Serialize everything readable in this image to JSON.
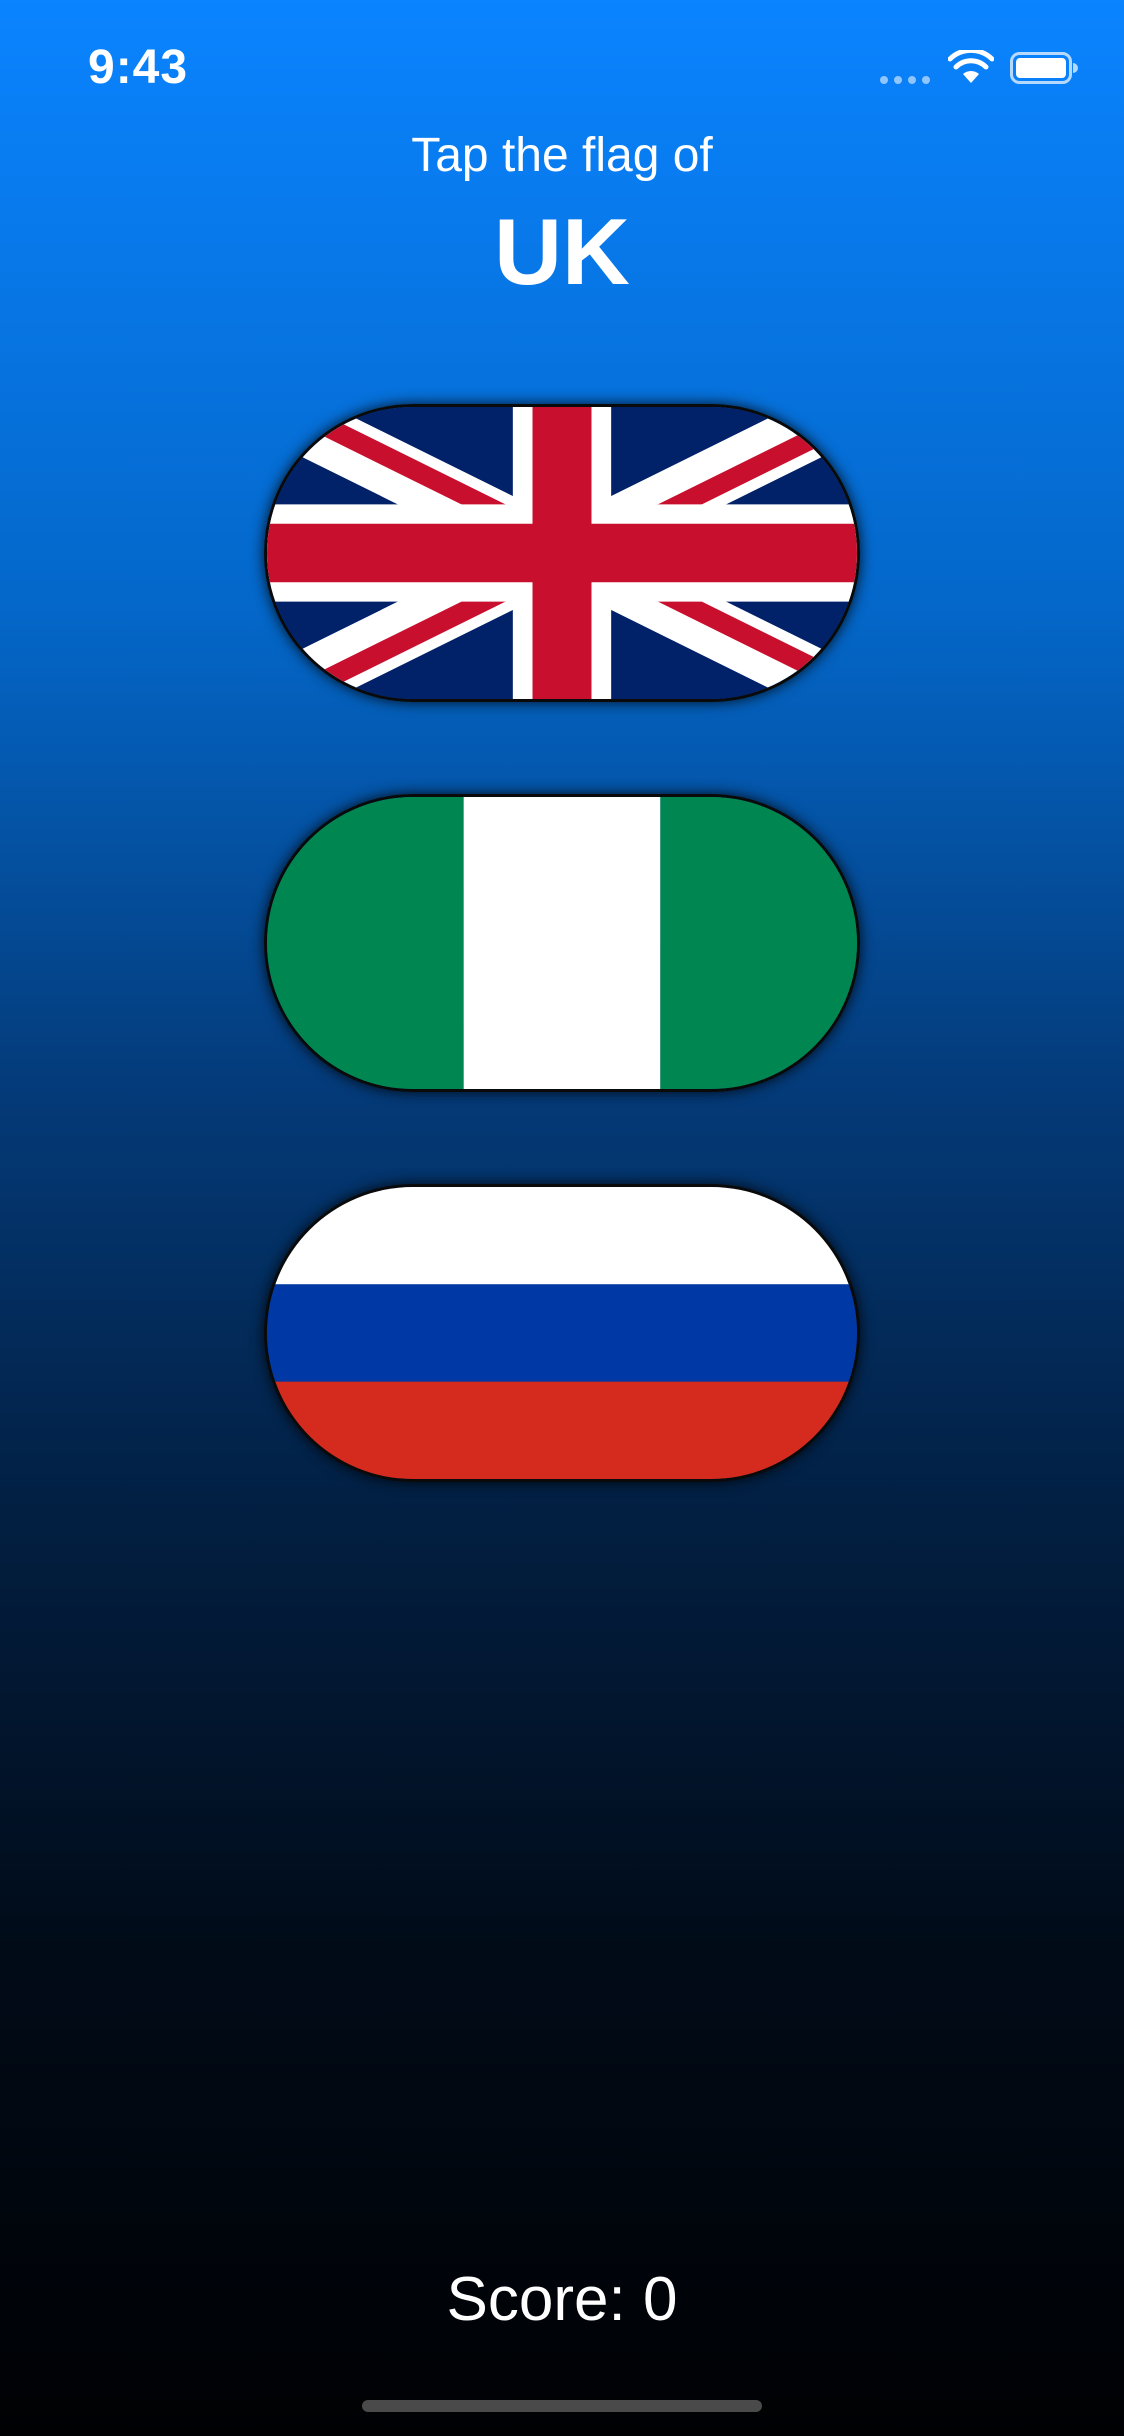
{
  "status_bar": {
    "time": "9:43",
    "icons": [
      "signal-dots-icon",
      "wifi-icon",
      "battery-icon"
    ]
  },
  "header": {
    "prompt": "Tap the flag of",
    "country": "UK"
  },
  "flags": [
    {
      "icon": "uk-flag-icon"
    },
    {
      "icon": "nigeria-flag-icon"
    },
    {
      "icon": "russia-flag-icon"
    }
  ],
  "footer": {
    "score": "Score: 0"
  },
  "colors": {
    "background_top": "#0a84ff",
    "background_bottom": "#000103",
    "uk_blue": "#012169",
    "uk_red": "#c8102e",
    "nigeria_green": "#008751",
    "russia_blue": "#0039a6",
    "russia_red": "#d52b1e"
  }
}
